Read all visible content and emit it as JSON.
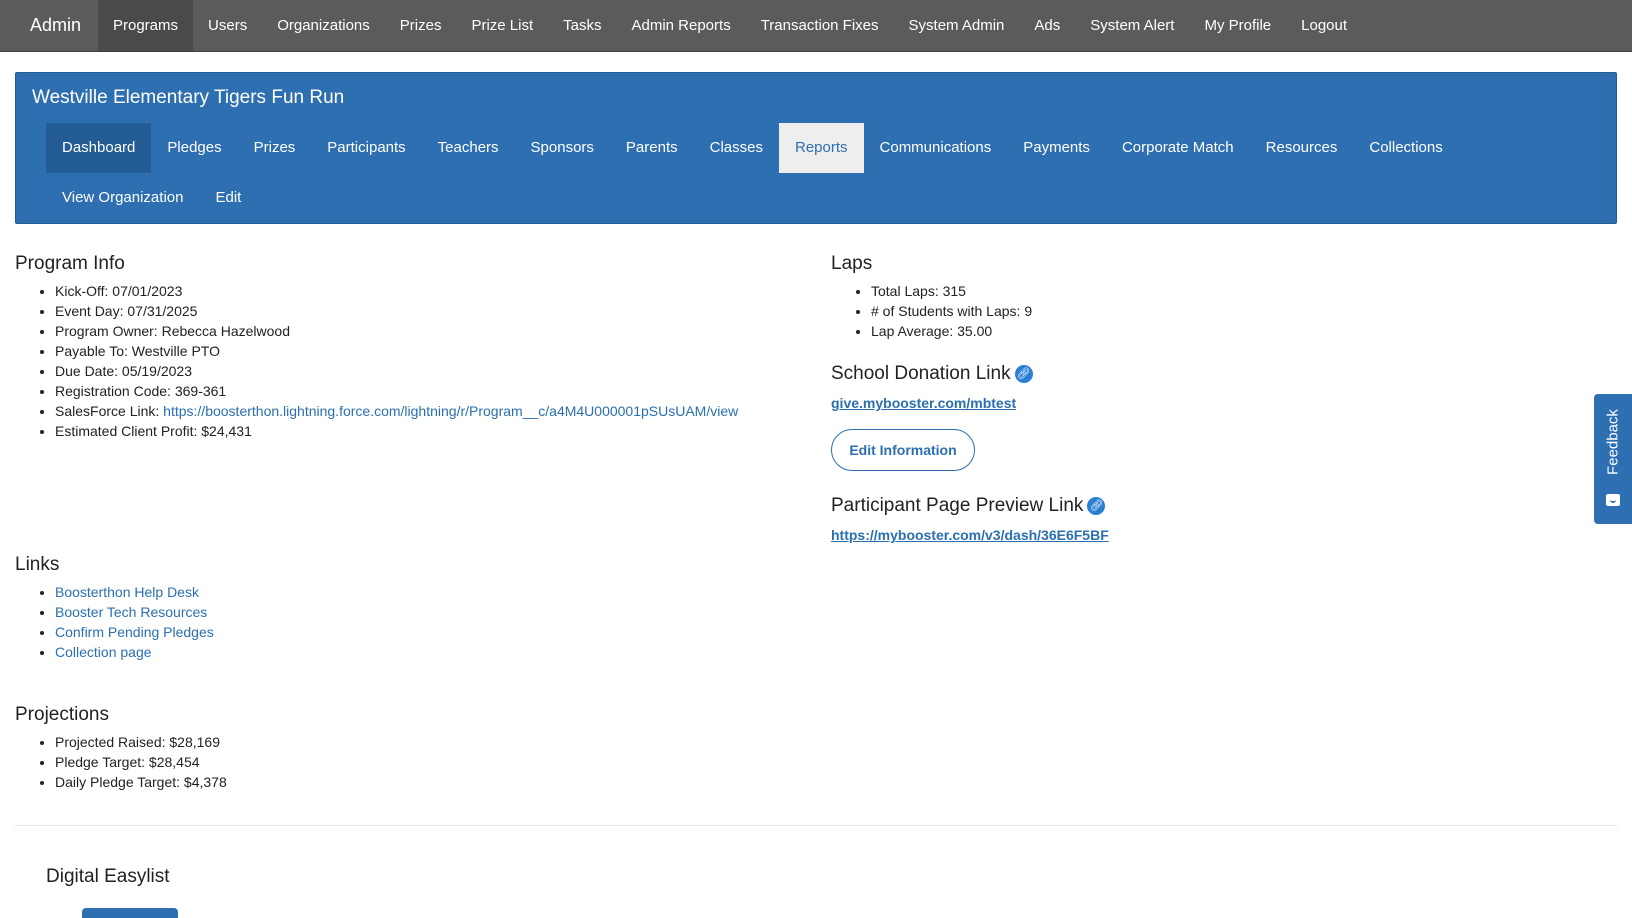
{
  "topnav": {
    "brand": "Admin",
    "items": [
      "Programs",
      "Users",
      "Organizations",
      "Prizes",
      "Prize List",
      "Tasks",
      "Admin Reports",
      "Transaction Fixes",
      "System Admin",
      "Ads",
      "System Alert",
      "My Profile",
      "Logout"
    ],
    "active": "Programs"
  },
  "program": {
    "title": "Westville Elementary Tigers Fun Run",
    "tabs": [
      "Dashboard",
      "Pledges",
      "Prizes",
      "Participants",
      "Teachers",
      "Sponsors",
      "Parents",
      "Classes",
      "Reports",
      "Communications",
      "Payments",
      "Corporate Match",
      "Resources",
      "Collections",
      "View Organization",
      "Edit"
    ],
    "active_tab": "Reports"
  },
  "program_info": {
    "heading": "Program Info",
    "kickoff": "Kick-Off: 07/01/2023",
    "event_day": "Event Day: 07/31/2025",
    "owner": "Program Owner: Rebecca Hazelwood",
    "payable_to": "Payable To: Westville PTO",
    "due_date": "Due Date: 05/19/2023",
    "registration_code": "Registration Code: 369-361",
    "salesforce_label": "SalesForce Link: ",
    "salesforce_url": "https://boosterthon.lightning.force.com/lightning/r/Program__c/a4M4U000001pSUsUAM/view",
    "profit": "Estimated Client Profit: $24,431"
  },
  "links": {
    "heading": "Links",
    "help_desk": "Boosterthon Help Desk",
    "tech_resources": "Booster Tech Resources",
    "confirm_pledges": "Confirm Pending Pledges",
    "collection_page": "Collection page"
  },
  "projections": {
    "heading": "Projections",
    "raised": "Projected Raised: $28,169",
    "pledge_target": "Pledge Target: $28,454",
    "daily_target": "Daily Pledge Target: $4,378"
  },
  "laps": {
    "heading": "Laps",
    "total": "Total Laps: 315",
    "students": "# of Students with Laps: 9",
    "average": "Lap Average: 35.00"
  },
  "donation": {
    "heading": "School Donation Link",
    "url": "give.mybooster.com/mbtest",
    "edit_button": "Edit Information"
  },
  "preview": {
    "heading": "Participant Page Preview Link",
    "url": "https://mybooster.com/v3/dash/36E6F5BF"
  },
  "easylist": {
    "heading": "Digital Easylist"
  },
  "feedback": {
    "label": "Feedback"
  }
}
